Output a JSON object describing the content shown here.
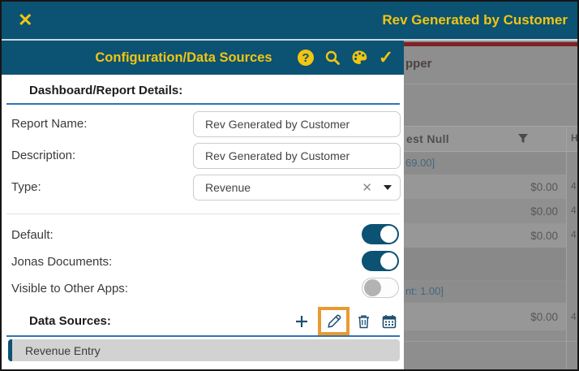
{
  "colors": {
    "teal": "#0b5273",
    "gold": "#f2c511",
    "accent_blue": "#2e75b6",
    "highlight_orange": "#e89b30"
  },
  "app_bar": {
    "title": "Rev Generated by Customer",
    "close_glyph": "✕"
  },
  "panel": {
    "title": "Configuration/Data Sources",
    "header_icons": [
      "help",
      "search",
      "palette",
      "confirm"
    ],
    "help_glyph": "?",
    "confirm_glyph": "✓",
    "section_title": "Dashboard/Report Details:",
    "fields": [
      {
        "label": "Report Name:",
        "value": "Rev Generated by Customer"
      },
      {
        "label": "Description:",
        "value": "Rev Generated by Customer"
      },
      {
        "label": "Type:",
        "value": "Revenue",
        "clear_glyph": "✕"
      }
    ],
    "toggles": [
      {
        "label": "Default:",
        "state": "on"
      },
      {
        "label": "Jonas Documents:",
        "state": "on"
      },
      {
        "label": "Visible to Other Apps:",
        "state": "off"
      }
    ],
    "data_sources_label": "Data Sources:",
    "data_source_actions": [
      "add",
      "edit",
      "delete",
      "schedule"
    ],
    "highlighted_action": "edit",
    "data_source_items": [
      "Revenue Entry"
    ]
  },
  "background": {
    "partial_report_title": "pper",
    "table": {
      "column_header_partial": "est Null",
      "column2_header_partial": "H",
      "group1_label_partial": "69.00]",
      "group1_values": [
        "$0.00",
        "$0.00",
        "$0.00"
      ],
      "group1_col2_partials": [
        "4",
        "4",
        "4"
      ],
      "group2_label_partial": "nt: 1.00]",
      "group2_values": [
        "$0.00"
      ],
      "group2_col2_partials": [
        "4"
      ]
    }
  }
}
